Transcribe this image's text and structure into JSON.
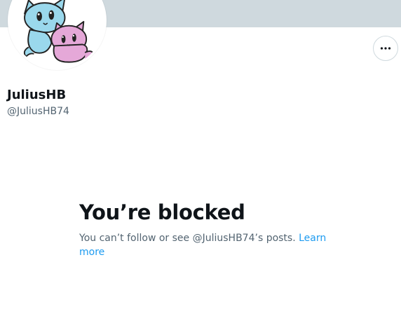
{
  "profile": {
    "display_name": "JuliusHB",
    "handle": "@JuliusHB74",
    "avatar_icon": "cartoon-cats-avatar"
  },
  "actions": {
    "more_icon": "more-horizontal-icon"
  },
  "blocked": {
    "title": "You’re blocked",
    "description": "You can’t follow or see @JuliusHB74’s posts. ",
    "learn_more": "Learn more"
  },
  "colors": {
    "banner": "#cfd9de",
    "primary_text": "#0f1419",
    "secondary_text": "#536471",
    "link": "#1d9bf0"
  }
}
